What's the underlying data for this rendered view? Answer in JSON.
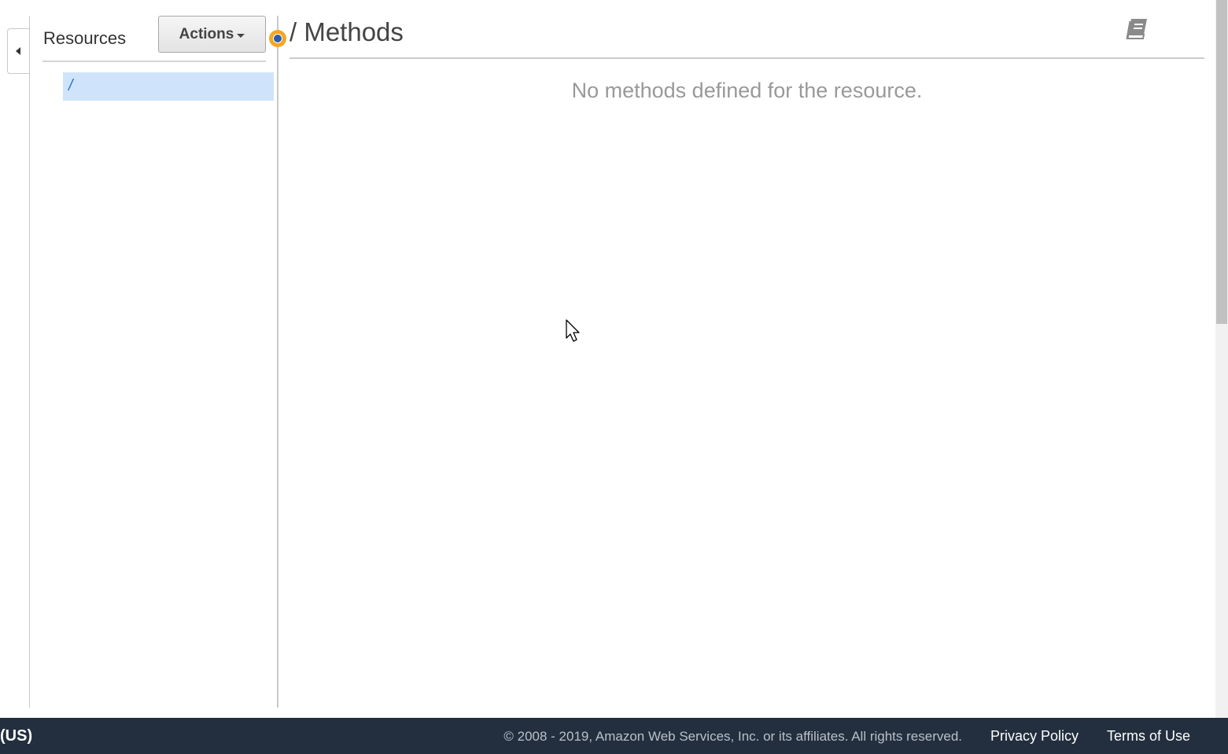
{
  "sidebar": {
    "title": "Resources",
    "actions_label": "Actions",
    "tree": [
      {
        "label": "/"
      }
    ]
  },
  "main": {
    "title": "/ Methods",
    "empty_message": "No methods defined for the resource."
  },
  "footer": {
    "region_fragment": "(US)",
    "copyright": "© 2008 - 2019, Amazon Web Services, Inc. or its affiliates. All rights reserved.",
    "privacy_label": "Privacy Policy",
    "terms_label": "Terms of Use"
  },
  "colors": {
    "selection_bg": "#cfe4fb",
    "selection_text": "#2a73c7",
    "status_dot": "#f5a623",
    "footer_bg": "#232f3e"
  },
  "icons": {
    "collapse": "caret-left-icon",
    "dropdown": "chevron-down-icon",
    "status": "status-dot-icon",
    "docs": "book-icon",
    "cursor": "mouse-pointer-icon"
  }
}
